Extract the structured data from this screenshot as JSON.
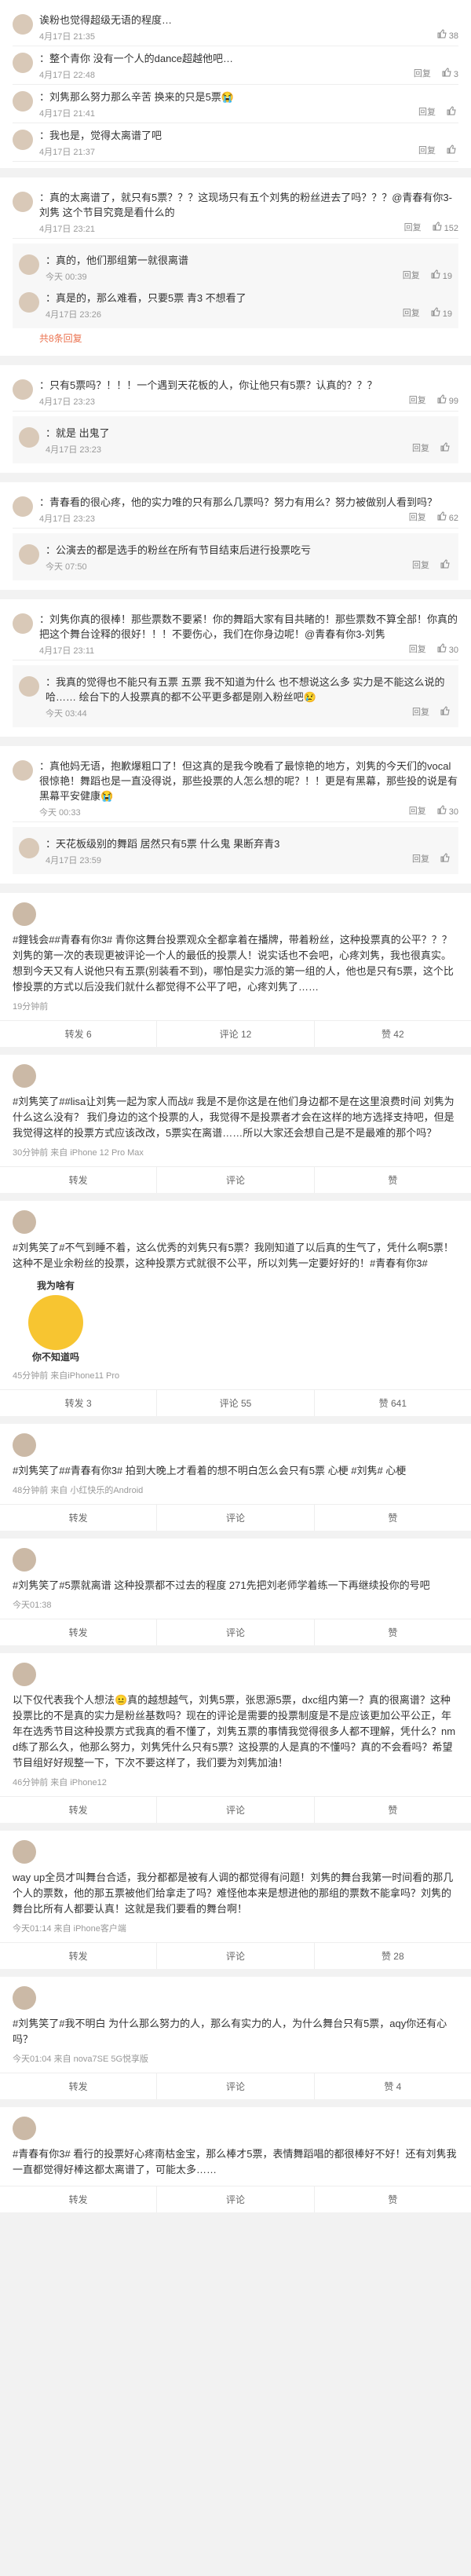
{
  "colors": {
    "accent": "#eb7350",
    "link": "#eb7350"
  },
  "block1": [
    {
      "text": "诶粉也觉得超级无语的程度…",
      "meta": "4月17日 21:35",
      "likes": "38"
    },
    {
      "text": "：整个青你 没有一个人的dance超越他吧…",
      "meta": "4月17日 22:48",
      "reply": "回复",
      "likes": "3"
    },
    {
      "text": "：刘隽那么努力那么辛苦 换来的只是5票😭",
      "meta": "4月17日 21:41",
      "reply": "回复",
      "likes": ""
    },
    {
      "text": "：我也是，觉得太离谱了吧",
      "meta": "4月17日 21:37",
      "reply": "回复",
      "likes": ""
    }
  ],
  "block2": {
    "main": {
      "text": "：真的太离谱了，就只有5票？？？这现场只有五个刘隽的粉丝进去了吗？？？@青春有你3-刘隽 这个节目究竟是看什么的",
      "meta": "4月17日 23:21",
      "reply": "回复",
      "likes": "152"
    },
    "subs": [
      {
        "text": "：真的，他们那组第一就很离谱",
        "meta": "今天 00:39",
        "reply": "回复",
        "likes": "19"
      },
      {
        "text": "：真是的，那么难看，只要5票 青3 不想看了",
        "meta": "4月17日 23:26",
        "reply": "回复",
        "likes": "19"
      }
    ],
    "more": "共8条回复"
  },
  "block3": {
    "main": {
      "text": "：只有5票吗？！！！一个遇到天花板的人，你让他只有5票？认真的？？？",
      "meta": "4月17日 23:23",
      "reply": "回复",
      "likes": "99"
    },
    "subs": [
      {
        "text": "：就是 出鬼了",
        "meta": "4月17日 23:23",
        "reply": "回复",
        "likes": ""
      }
    ]
  },
  "block4": {
    "main": {
      "text": "：青春看的很心疼，他的实力唯的只有那么几票吗？努力有用么？努力被做别人看到吗？",
      "meta": "4月17日 23:23",
      "reply": "回复",
      "likes": "62"
    },
    "subs": [
      {
        "text": "：公演去的都是选手的粉丝在所有节目结束后进行投票吃亏",
        "meta": "今天 07:50",
        "reply": "回复",
        "likes": ""
      }
    ]
  },
  "block5": {
    "main": {
      "text": "：刘隽你真的很棒！那些票数不要紧！你的舞蹈大家有目共睹的！那些票数不算全部！你真的把这个舞台诠释的很好！！！不要伤心，我们在你身边呢！@青春有你3-刘隽",
      "meta": "4月17日 23:11",
      "reply": "回复",
      "likes": "30"
    },
    "subs": [
      {
        "text": "：我真的觉得也不能只有五票 五票 我不知道为什么 也不想说这么多 实力是不能这么说的哈…… 绘台下的人投票真的都不公平更多都是刚入粉丝吧😢",
        "meta": "今天 03:44",
        "reply": "回复",
        "likes": ""
      }
    ]
  },
  "block6": {
    "main": {
      "text": "：真他妈无语，抱歉爆粗口了！但这真的是我今晚看了最惊艳的地方，刘隽的今天们的vocal很惊艳！舞蹈也是一直没得说，那些投票的人怎么想的呢？！！更是有黑幕，那些投的说是有黑幕平安健康😭",
      "meta": "今天 00:33",
      "reply": "回复",
      "likes": "30"
    },
    "subs": [
      {
        "text": "：天花板级别的舞蹈 居然只有5票 什么鬼 果断弃青3",
        "meta": "4月17日 23:59",
        "reply": "回复",
        "likes": ""
      }
    ]
  },
  "posts": [
    {
      "text": "#鋰钱会##青春有你3# 青你这舞台投票观众全都拿着在播牌，带着粉丝，这种投票真的公平？？？刘隽的第一次的表现更被评论一个人的最低的投票人！说实话也不会吧，心疼刘隽，我也很真实。想到今天又有人说他只有五票(别装看不到)，哪怕是实力派的第一组的人，他也是只有5票，这个比惨投票的方式以后没我们就什么都觉得不公平了吧，心疼刘隽了……",
      "meta": "19分钟前",
      "bar": [
        "转发 6",
        "评论 12",
        "赞 42"
      ]
    },
    {
      "text": "#刘隽笑了##lisa让刘隽一起为家人而战# 我是不是你这是在他们身边都不是在这里浪费时间 刘隽为什么这么没有？ 我们身边的这个投票的人，我觉得不是投票者才会在这样的地方选择支持吧，但是我觉得这样的投票方式应该改改，5票实在离谱……所以大家还会想自己是不是最难的那个吗？",
      "meta": "30分钟前 来自 iPhone 12 Pro Max",
      "bar": [
        "转发",
        "评论",
        "赞"
      ]
    },
    {
      "text": "#刘隽笑了#不气到睡不着，这么优秀的刘隽只有5票？我刚知道了以后真的生气了，凭什么啊5票！这种不是业余粉丝的投票，这种投票方式就很不公平，所以刘隽一定要好好的！#青春有你3#",
      "sticker": {
        "top": "我为啥有",
        "bottom": "你不知道吗"
      },
      "meta": "45分钟前 来自iPhone11 Pro",
      "bar": [
        "转发 3",
        "评论 55",
        "赞 641"
      ]
    },
    {
      "text": "#刘隽笑了##青春有你3# 拍到大晚上才看着的想不明白怎么会只有5票 心梗 #刘隽# 心梗",
      "meta": "48分钟前 来自 小红快乐的Android",
      "bar": [
        "转发",
        "评论",
        "赞"
      ]
    },
    {
      "text": "#刘隽笑了#5票就离谱 这种投票都不过去的程度 271先把刘老师学着练一下再继续投你的号吧",
      "meta": "今天01:38",
      "bar": [
        "转发",
        "评论",
        "赞"
      ]
    },
    {
      "text": "以下仅代表我个人想法😐真的越想越气，刘隽5票，张思源5票，dxc组内第一？真的很离谱？这种投票比的不是真的实力是粉丝基数吗？现在的评论是需要的投票制度是不是应该更加公平公正，年年在选秀节目这种投票方式我真的看不懂了，刘隽五票的事情我觉得很多人都不理解，凭什么？nmd练了那么久，他那么努力，刘隽凭什么只有5票？这投票的人是真的不懂吗？真的不会看吗？希望节目组好好规整一下，下次不要这样了，我们要为刘隽加油！",
      "meta": "46分钟前 来自 iPhone12",
      "bar": [
        "转发",
        "评论",
        "赞"
      ]
    },
    {
      "text": "way up全员才叫舞台合适，我分都都是被有人调的都觉得有问题！刘隽的舞台我第一时间看的那几个人的票数，他的那五票被他们给拿走了吗？难怪他本来是想进他的那组的票数不能拿吗？刘隽的舞台比所有人都要认真！这就是我们要看的舞台啊！",
      "meta": "今天01:14 来自 iPhone客户端",
      "bar": [
        "转发",
        "评论",
        "赞 28"
      ]
    },
    {
      "text": "#刘隽笑了#我不明白 为什么那么努力的人，那么有实力的人，为什么舞台只有5票，aqy你还有心吗？",
      "meta": "今天01:04 来自 nova7SE 5G悦享版",
      "bar": [
        "转发",
        "评论",
        "赞 4"
      ]
    },
    {
      "text": "#青春有你3# 看行的投票好心疼南枯金宝，那么棒才5票，表情舞蹈唱的都很棒好不好！还有刘隽我一直都觉得好棒这都太离谱了，可能太多……",
      "meta": "",
      "bar": [
        "转发",
        "评论",
        "赞"
      ]
    }
  ]
}
